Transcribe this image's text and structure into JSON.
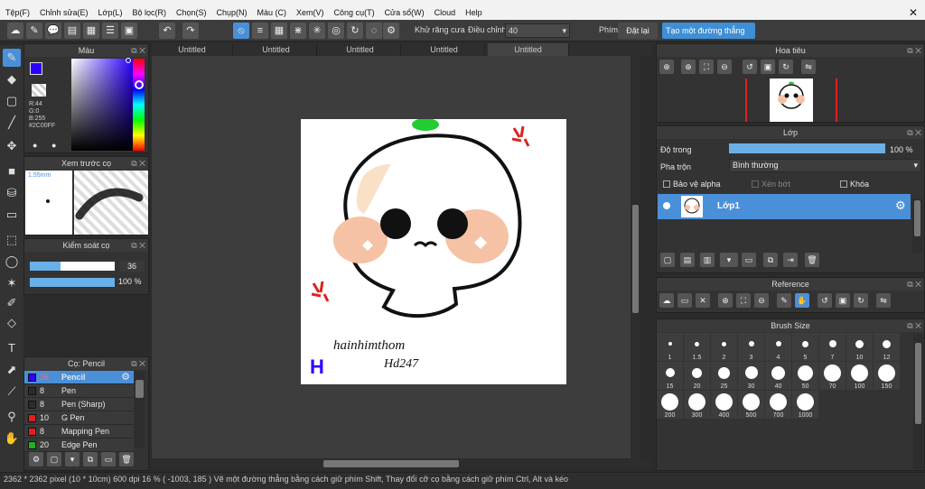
{
  "menu": [
    "Tệp(F)",
    "Chỉnh sửa(E)",
    "Lớp(L)",
    "Bộ lọc(R)",
    "Chọn(S)",
    "Chụp(N)",
    "Màu (C)",
    "Xem(V)",
    "Công cụ(T)",
    "Cửa sổ(W)",
    "Cloud",
    "Help"
  ],
  "toolbar": {
    "antialias_label": "Khử răng cưa",
    "correction_label": "Điều chỉnh",
    "correction_value": "40",
    "key_label": "Phím",
    "reset_label": "Đặt lại",
    "straight_line_label": "Tạo một đường thẳng"
  },
  "tabs": [
    "Untitled",
    "Untitled",
    "Untitled",
    "Untitled",
    "Untitled"
  ],
  "color_panel": {
    "title": "Màu",
    "r": "R:44",
    "g": "G:0",
    "b": "B:255",
    "hex": "#2C00FF",
    "primary": "#2c00ff"
  },
  "preview_panel": {
    "title": "Xem trước cọ",
    "size": "1.55mm"
  },
  "brush_control": {
    "title": "Kiểm soát cọ",
    "size": "36",
    "size_fraction": 0.36,
    "opacity": "100 %",
    "opacity_fraction": 1.0
  },
  "brush_panel": {
    "title": "Cọ: Pencil",
    "items": [
      {
        "size": "36",
        "name": "Pencil",
        "color": "#2c00ff",
        "selected": true
      },
      {
        "size": "8",
        "name": "Pen",
        "color": "#2c2c2c",
        "selected": false
      },
      {
        "size": "8",
        "name": "Pen (Sharp)",
        "color": "#2c2c2c",
        "selected": false
      },
      {
        "size": "10",
        "name": "G Pen",
        "color": "#e02020",
        "selected": false
      },
      {
        "size": "8",
        "name": "Mapping Pen",
        "color": "#e02020",
        "selected": false
      },
      {
        "size": "20",
        "name": "Edge Pen",
        "color": "#20b020",
        "selected": false
      }
    ]
  },
  "navigator": {
    "title": "Hoa tiêu"
  },
  "layer_panel": {
    "title": "Lớp",
    "opacity_label": "Độ trong",
    "opacity_value": "100 %",
    "opacity_fraction": 1.0,
    "blend_label": "Pha trộn",
    "blend_value": "Bình thường",
    "protect_alpha": "Bảo vệ alpha",
    "clipping": "Xén bớt",
    "lock": "Khóa",
    "layer_name": "Lớp1"
  },
  "reference": {
    "title": "Reference"
  },
  "brush_size": {
    "title": "Brush Size",
    "sizes": [
      "1",
      "1.5",
      "2",
      "3",
      "4",
      "5",
      "7",
      "10",
      "12",
      "15",
      "20",
      "25",
      "30",
      "40",
      "50",
      "70",
      "100",
      "150",
      "200",
      "300",
      "400",
      "500",
      "700",
      "1000"
    ]
  },
  "canvas_art": {
    "signature_line1": "hainhimthom",
    "signature_line2": "Hd247",
    "letter_mark": "H"
  },
  "status": "2362 * 2362 pixel  (10 * 10cm)  600 dpi  16 %  ( -1003, 185 )  Vẽ một đường thẳng bằng cách giữ phím Shift, Thay đổi cỡ cọ bằng cách giữ phím Ctrl, Alt và kéo",
  "colors": {
    "accent": "#3f8fd6",
    "panel": "#333333",
    "sprout": "#22cc33",
    "anger": "#dd2222",
    "blush": "#f5c2a5",
    "skin_shade": "#fbe0c8"
  }
}
